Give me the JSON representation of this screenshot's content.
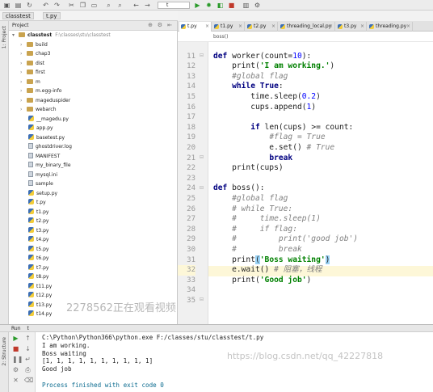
{
  "toolbar": {
    "run_config": "t"
  },
  "navbar": {
    "project": "classtest",
    "file": "t.py"
  },
  "sidebar_tools": {
    "project": "1: Project",
    "structure": "2: Structure",
    "favorites": "Favorites"
  },
  "project_panel": {
    "title": "Project",
    "root": "classtest",
    "root_path": "F:\\classes\\stu\\classtest",
    "folders": [
      "build",
      "chap3",
      "dist",
      "first",
      "m",
      "m.egg-info",
      "mageduspider",
      "webarch"
    ],
    "files": [
      "__magedu.py",
      "app.py",
      "basetest.py",
      "ghostdriver.log",
      "MANIFEST",
      "my_binary_file",
      "mysql.ini",
      "sample",
      "setup.py",
      "t.py",
      "t1.py",
      "t2.py",
      "t3.py",
      "t4.py",
      "t5.py",
      "t6.py",
      "t7.py",
      "t8.py",
      "t11.py",
      "t12.py",
      "t13.py",
      "t14.py"
    ]
  },
  "tabs": [
    {
      "label": "t.py",
      "active": true
    },
    {
      "label": "t1.py",
      "active": false
    },
    {
      "label": "t2.py",
      "active": false
    },
    {
      "label": "threading_local.py",
      "active": false
    },
    {
      "label": "t3.py",
      "active": false
    },
    {
      "label": "threading.py",
      "active": false
    }
  ],
  "editor": {
    "breadcrumb": "boss()",
    "line_numbers": [
      "11",
      "12",
      "13",
      "14",
      "15",
      "16",
      "17",
      "18",
      "19",
      "20",
      "21",
      "22",
      "23",
      "24",
      "25",
      "26",
      "27",
      "28",
      "29",
      "30",
      "31",
      "32",
      "33",
      "34",
      "35"
    ],
    "highlighted_line": "32"
  },
  "watermark": "2278562正在观看视频",
  "run": {
    "tab_label": "Run",
    "config": "t",
    "console_lines": [
      "C:\\Python\\Python366\\python.exe F:/classes/stu/classtest/t.py",
      "I am working.",
      "Boss waiting",
      "[1, 1, 1, 1, 1, 1, 1, 1, 1, 1]",
      "Good job",
      "",
      "Process finished with exit code 0"
    ]
  },
  "blog_watermark": "https://blog.csdn.net/qq_42227818"
}
